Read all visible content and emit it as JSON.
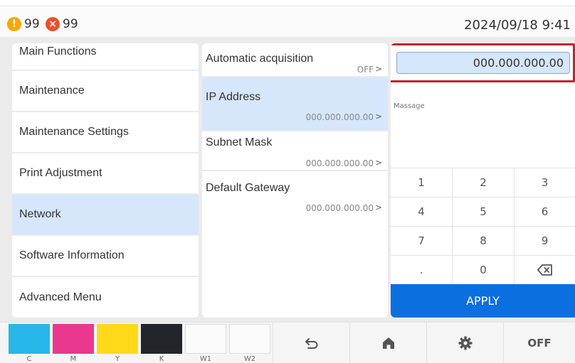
{
  "status": {
    "warning": {
      "icon": "warning-icon",
      "count": "99",
      "color": "#f5a800"
    },
    "error": {
      "icon": "error-icon",
      "count": "99",
      "color": "#e8512f"
    },
    "datetime": "2024/09/18 9:41"
  },
  "menu": {
    "items": [
      {
        "label": "Main Functions",
        "active": false
      },
      {
        "label": "Maintenance",
        "active": false
      },
      {
        "label": "Maintenance Settings",
        "active": false
      },
      {
        "label": "Print Adjustment",
        "active": false
      },
      {
        "label": "Network",
        "active": true
      },
      {
        "label": "Software Information",
        "active": false
      },
      {
        "label": "Advanced Menu",
        "active": false
      }
    ]
  },
  "network_list": {
    "items": [
      {
        "label": "Automatic acquisition",
        "value": "OFF",
        "active": false
      },
      {
        "label": "IP Address",
        "value": "000.000.000.00",
        "active": true
      },
      {
        "label": "Subnet Mask",
        "value": "000.000.000.00",
        "active": false
      },
      {
        "label": "Default Gateway",
        "value": "000.000.000.00",
        "active": false
      }
    ],
    "chevron": ">"
  },
  "editor": {
    "input_value": "000.000.000.00",
    "message_label": "Massage",
    "keys": [
      "1",
      "2",
      "3",
      "4",
      "5",
      "6",
      "7",
      "8",
      "9",
      ".",
      "0"
    ],
    "backspace_icon": "backspace-icon",
    "apply_label": "APPLY",
    "apply_color": "#0c6fe0",
    "focus_color": "#c4202e"
  },
  "ink": [
    {
      "label": "C",
      "color": "#29b6e8"
    },
    {
      "label": "M",
      "color": "#e8398f"
    },
    {
      "label": "Y",
      "color": "#ffd91a"
    },
    {
      "label": "K",
      "color": "#22252a"
    },
    {
      "label": "W1",
      "color": "#fbfbfb"
    },
    {
      "label": "W2",
      "color": "#fbfbfb"
    }
  ],
  "nav": {
    "back_icon": "back-icon",
    "home_icon": "home-icon",
    "settings_icon": "gear-icon",
    "off_label": "OFF"
  }
}
